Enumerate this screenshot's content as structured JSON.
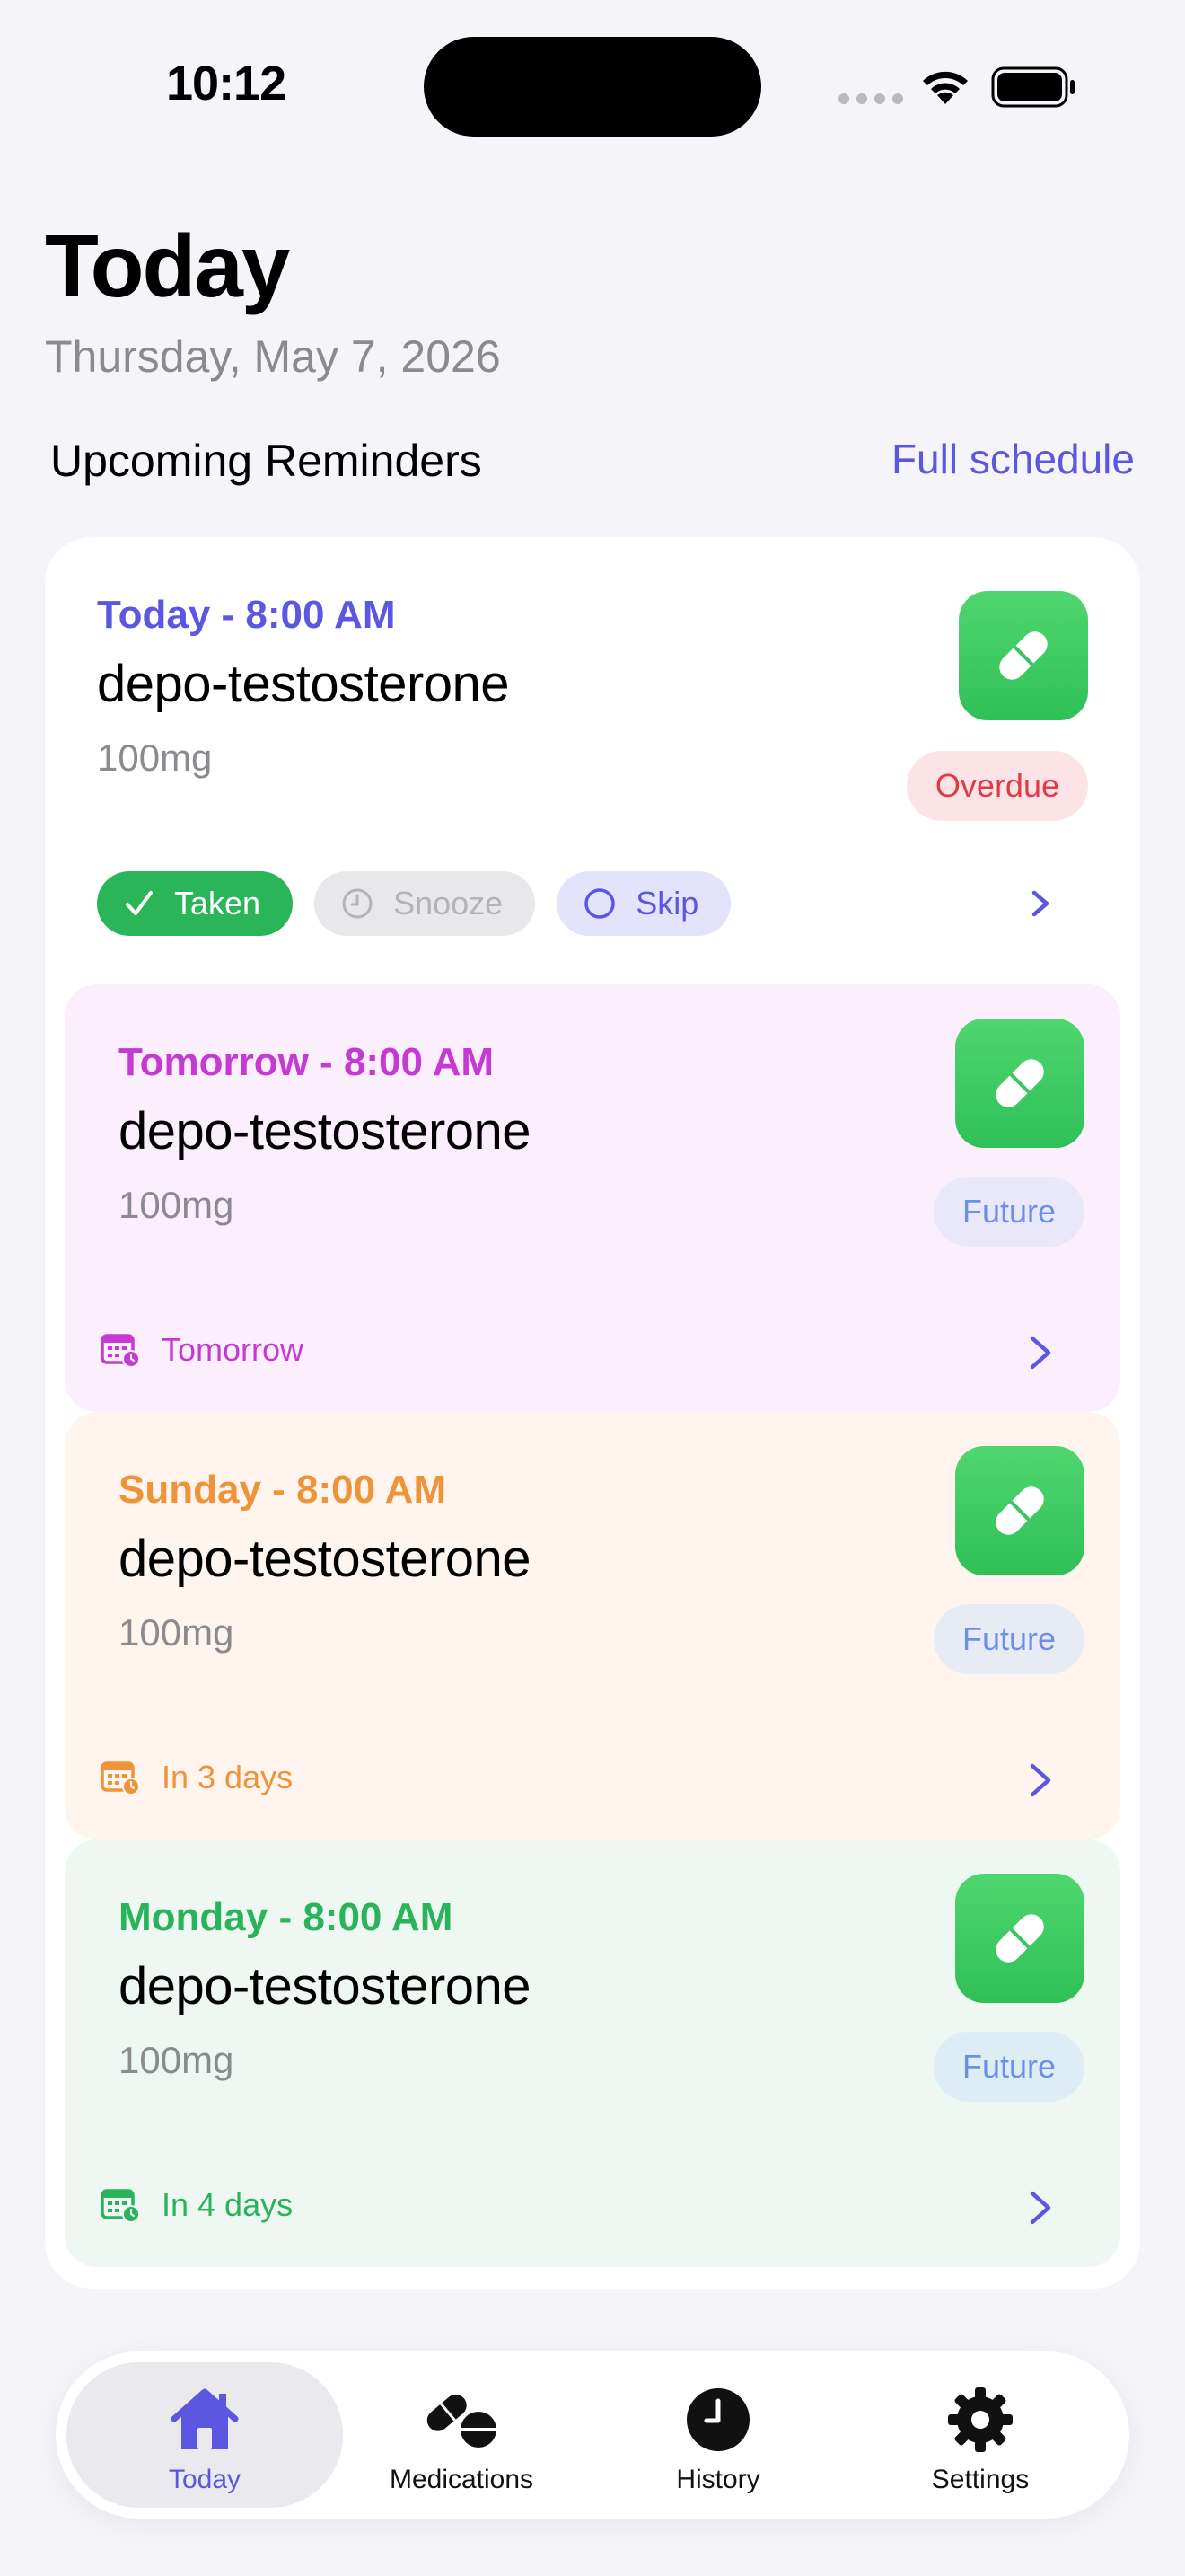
{
  "status_bar": {
    "time": "10:12"
  },
  "header": {
    "title": "Today",
    "date": "Thursday, May 7, 2026",
    "section_title": "Upcoming Reminders",
    "full_schedule_link": "Full schedule"
  },
  "reminders": [
    {
      "time_label": "Today - 8:00 AM",
      "name": "depo-testosterone",
      "dose": "100mg",
      "status": "Overdue",
      "actions": {
        "taken": "Taken",
        "snooze": "Snooze",
        "skip": "Skip"
      }
    },
    {
      "time_label": "Tomorrow - 8:00 AM",
      "name": "depo-testosterone",
      "dose": "100mg",
      "status": "Future",
      "when": "Tomorrow"
    },
    {
      "time_label": "Sunday - 8:00 AM",
      "name": "depo-testosterone",
      "dose": "100mg",
      "status": "Future",
      "when": "In 3 days"
    },
    {
      "time_label": "Monday - 8:00 AM",
      "name": "depo-testosterone",
      "dose": "100mg",
      "status": "Future",
      "when": "In 4 days"
    }
  ],
  "tab_bar": {
    "tabs": [
      {
        "label": "Today",
        "icon": "house-icon",
        "active": true
      },
      {
        "label": "Medications",
        "icon": "pills-icon",
        "active": false
      },
      {
        "label": "History",
        "icon": "clock-icon",
        "active": false
      },
      {
        "label": "Settings",
        "icon": "gear-icon",
        "active": false
      }
    ]
  },
  "colors": {
    "accent": "#5b57e0",
    "overdue": "#e03a48",
    "taken": "#2bb559",
    "tomorrow": "#c43ad3",
    "sunday": "#ef9338",
    "monday": "#2ab35a"
  }
}
